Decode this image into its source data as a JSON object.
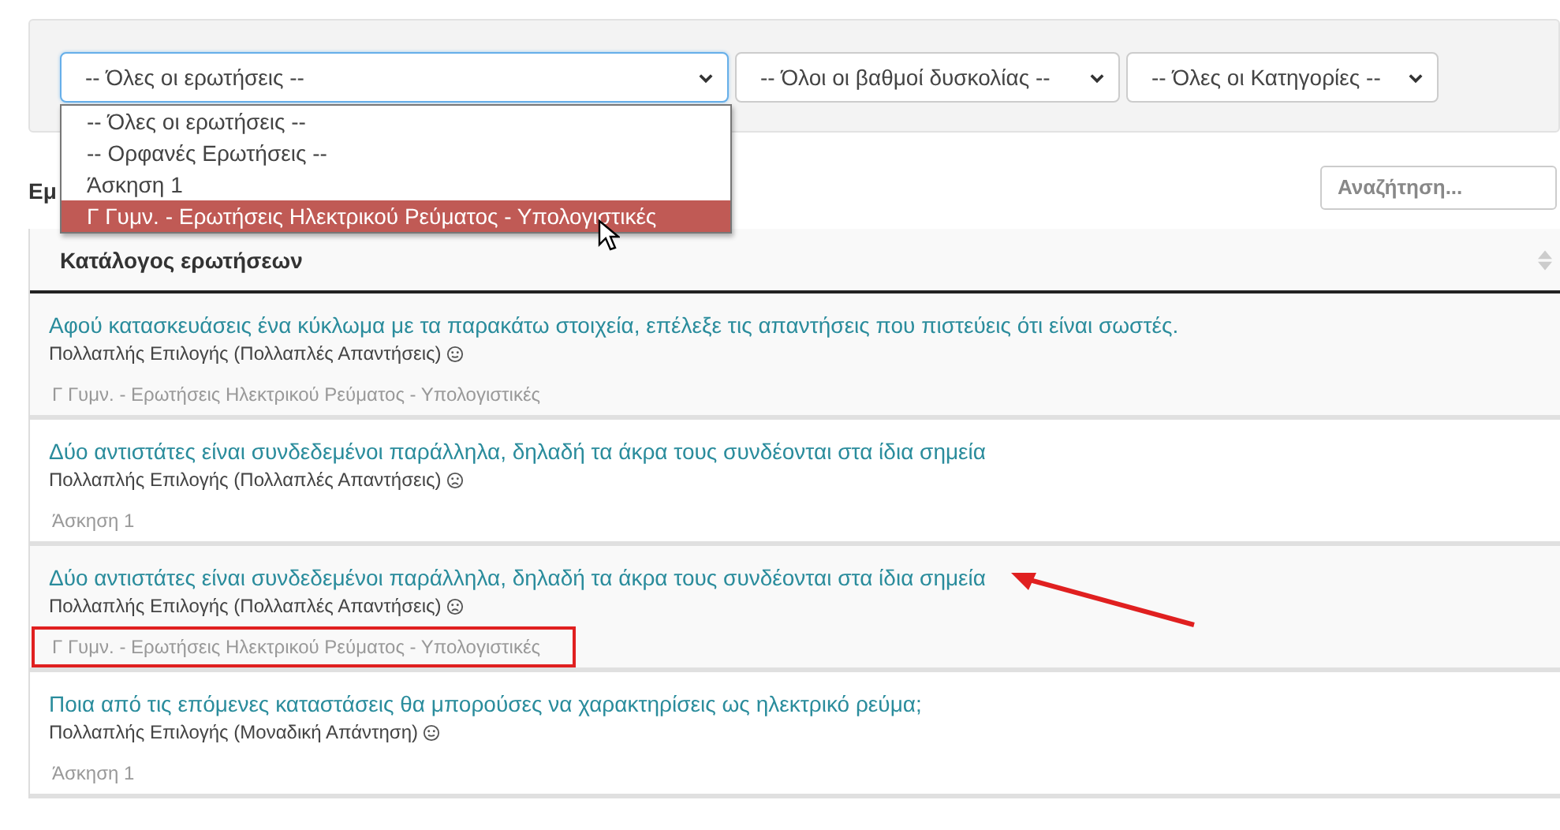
{
  "filters": [
    {
      "value": "-- Όλες οι ερωτήσεις --",
      "focused": true
    },
    {
      "value": "-- Όλοι οι βαθμοί δυσκολίας --",
      "focused": false
    },
    {
      "value": "-- Όλες οι Κατηγορίες --",
      "focused": false
    }
  ],
  "dropdown": {
    "options": [
      {
        "label": "-- Όλες οι ερωτήσεις --",
        "selected": false,
        "pointer": false
      },
      {
        "label": "-- Ορφανές Ερωτήσεις --",
        "selected": false,
        "pointer": false
      },
      {
        "label": "Άσκηση 1",
        "selected": false,
        "pointer": false
      },
      {
        "label": "Γ Γυμν. - Ερωτήσεις Ηλεκτρικού Ρεύματος - Υπολογιστικές",
        "selected": true,
        "pointer": true
      }
    ]
  },
  "section_label": "Εμ",
  "search": {
    "placeholder": "Αναζήτηση..."
  },
  "table": {
    "columns": [
      "Κατάλογος ερωτήσεων"
    ],
    "rows": [
      {
        "title": "Αφού κατασκευάσεις ένα κύκλωμα με τα παρακάτω στοιχεία, επέλεξε τις απαντήσεις που πιστεύεις ότι είναι σωστές.",
        "type": "Πολλαπλής Επιλογής (Πολλαπλές Απαντήσεις)",
        "sad": false,
        "category": "Γ Γυμν. - Ερωτήσεις Ηλεκτρικού Ρεύματος - Υπολογιστικές",
        "boxed": false,
        "arrow": false
      },
      {
        "title": "Δύο αντιστάτες είναι συνδεδεμένοι παράλληλα, δηλαδή τα άκρα τους συνδέονται στα ίδια σημεία",
        "type": "Πολλαπλής Επιλογής (Πολλαπλές Απαντήσεις)",
        "sad": true,
        "category": "Άσκηση 1",
        "boxed": false,
        "arrow": false
      },
      {
        "title": "Δύο αντιστάτες είναι συνδεδεμένοι παράλληλα, δηλαδή τα άκρα τους συνδέονται στα ίδια σημεία",
        "type": "Πολλαπλής Επιλογής (Πολλαπλές Απαντήσεις)",
        "sad": true,
        "category": "Γ Γυμν. - Ερωτήσεις Ηλεκτρικού Ρεύματος - Υπολογιστικές",
        "boxed": true,
        "arrow": true
      },
      {
        "title": "Ποια από τις επόμενες καταστάσεις θα μπορούσες να χαρακτηρίσεις ως ηλεκτρικό ρεύμα;",
        "type": "Πολλαπλής Επιλογής (Μοναδική Απάντηση)",
        "sad": false,
        "category": "Άσκηση 1",
        "boxed": false,
        "arrow": false
      }
    ]
  }
}
